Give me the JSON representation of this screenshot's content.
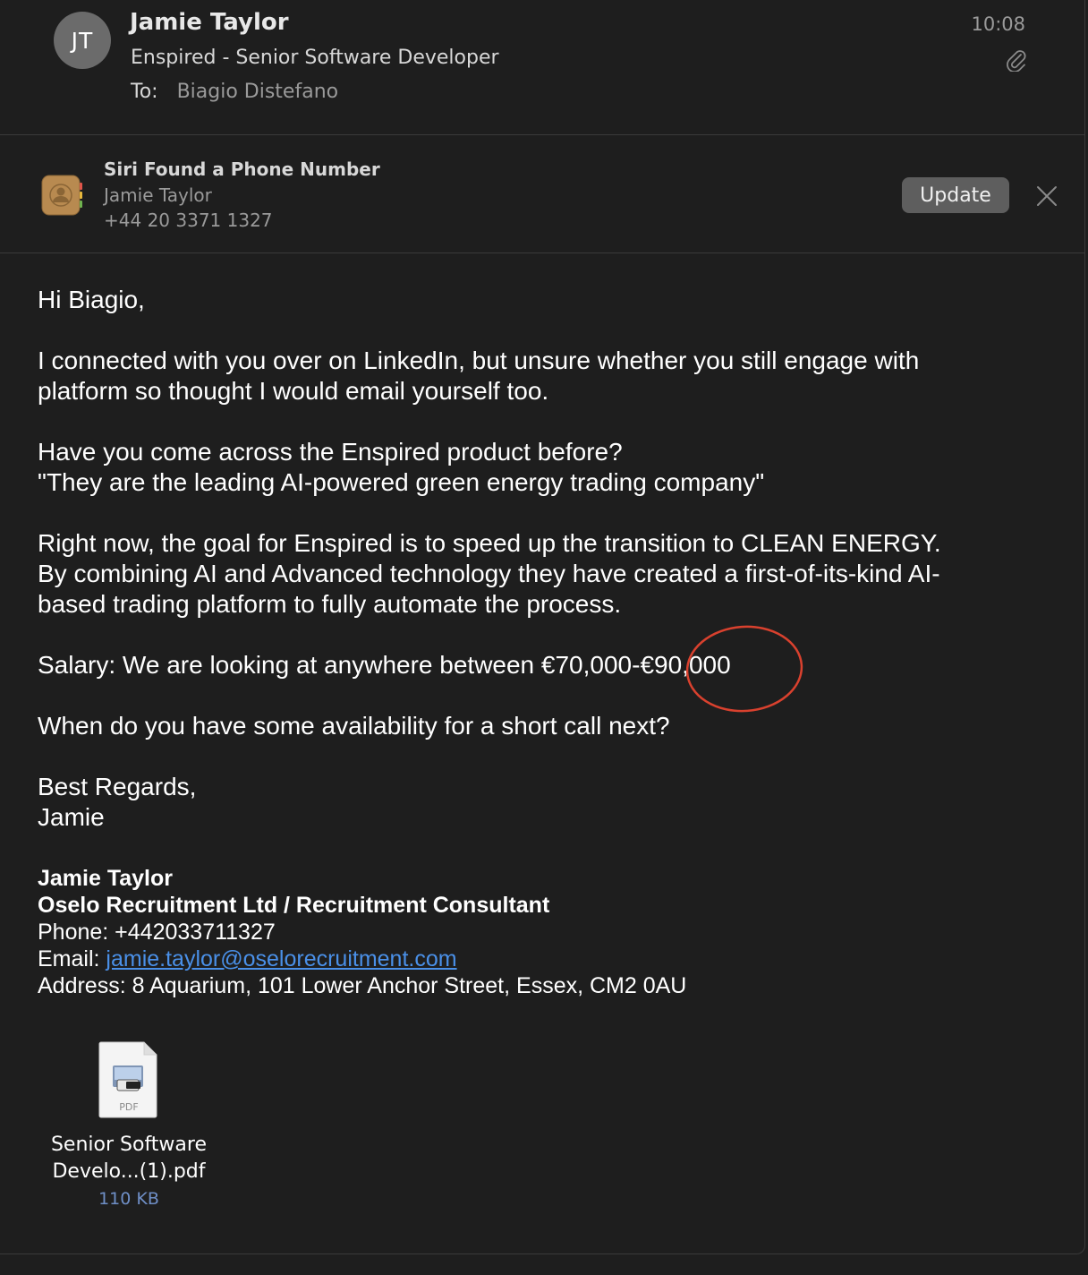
{
  "header": {
    "avatar_initials": "JT",
    "sender": "Jamie Taylor",
    "subject": "Enspired - Senior Software Developer",
    "to_label": "To:",
    "recipient": "Biagio Distefano",
    "time": "10:08",
    "attachment_indicator_icon": "paperclip-icon"
  },
  "siri_banner": {
    "icon": "contacts-icon",
    "title": "Siri Found a Phone Number",
    "name": "Jamie Taylor",
    "phone": "+44 20 3371 1327",
    "update_label": "Update",
    "close_icon": "close-icon"
  },
  "body": {
    "greeting": "Hi Biagio,",
    "para1_line1": "I connected with you over on LinkedIn, but unsure whether you still engage with",
    "para1_line2": "platform so thought I would email yourself too.",
    "para2_line1": "Have you come across the Enspired product before?",
    "para2_line2": "\"They are the leading AI-powered green energy trading company\"",
    "para3_line1": "Right now, the goal for Enspired is to speed up the transition to CLEAN ENERGY.",
    "para3_line2": "By combining AI and Advanced technology they have created a first-of-its-kind AI-",
    "para3_line3": "based trading platform to fully automate the process.",
    "salary": "Salary: We are looking at anywhere between €70,000-€90,000",
    "question": "When do you have some availability for a short call next?",
    "closing": "Best Regards,",
    "closing_name": "Jamie"
  },
  "annotation": {
    "circle_color": "#d9412e"
  },
  "signature": {
    "name": "Jamie Taylor",
    "company_role": "Oselo Recruitment Ltd / Recruitment Consultant",
    "phone": "Phone: +442033711327",
    "email_label": "Email: ",
    "email": "jamie.taylor@oselorecruitment.com",
    "address": "Address: 8 Aquarium, 101 Lower Anchor Street, Essex, CM2 0AU"
  },
  "attachment": {
    "icon": "pdf-file-icon",
    "type_label": "PDF",
    "name_line1": "Senior Software",
    "name_line2": "Develo...(1).pdf",
    "size": "110 KB"
  },
  "colors": {
    "background": "#1e1e1e",
    "link": "#4a90e8",
    "attachment_size": "#6f8fc7"
  }
}
